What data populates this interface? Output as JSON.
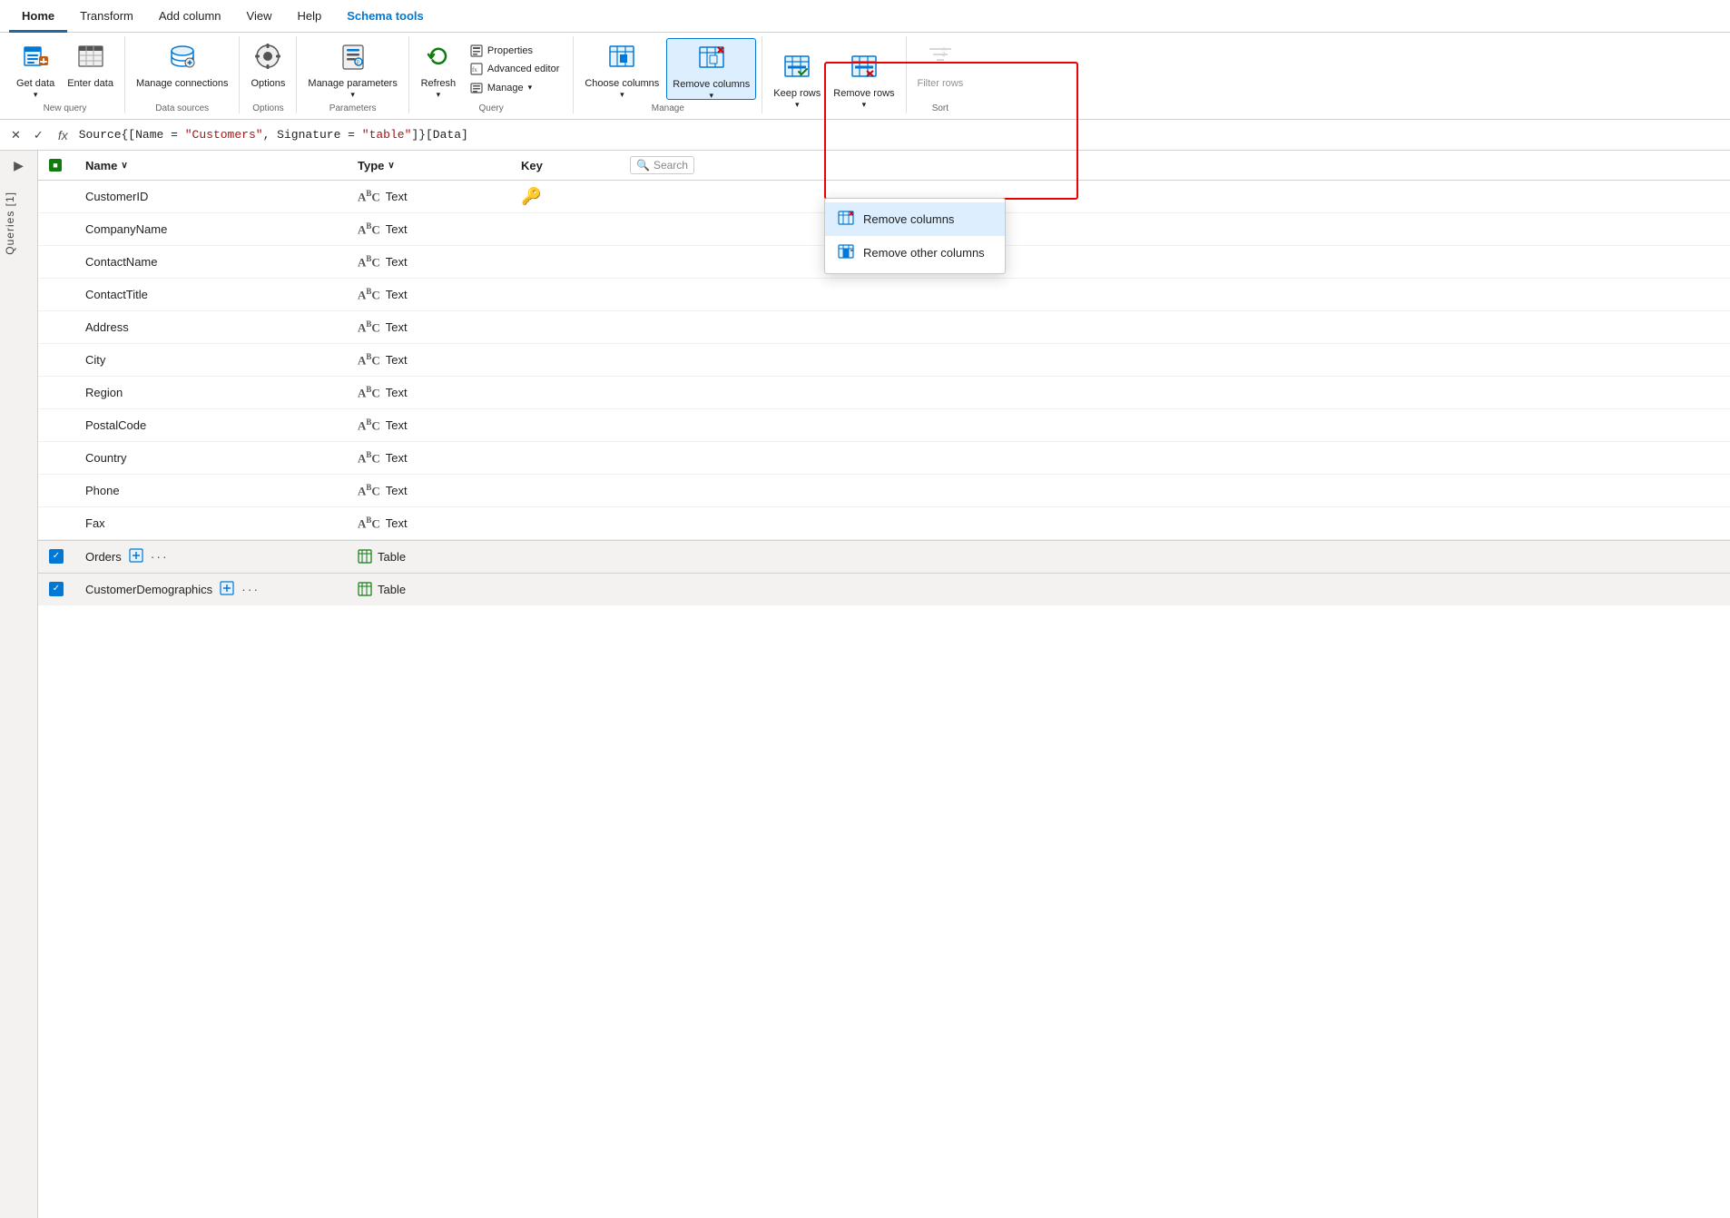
{
  "tabs": [
    {
      "label": "Home",
      "active": true
    },
    {
      "label": "Transform",
      "active": false
    },
    {
      "label": "Add column",
      "active": false
    },
    {
      "label": "View",
      "active": false
    },
    {
      "label": "Help",
      "active": false
    },
    {
      "label": "Schema tools",
      "active": false,
      "schema": true
    }
  ],
  "ribbon": {
    "groups": [
      {
        "label": "New query",
        "buttons": [
          {
            "id": "get-data",
            "label": "Get\ndata",
            "icon": "📊",
            "dropdown": true
          },
          {
            "id": "enter-data",
            "label": "Enter\ndata",
            "icon": "📋"
          }
        ]
      },
      {
        "label": "Data sources",
        "buttons": [
          {
            "id": "manage-connections",
            "label": "Manage\nconnections",
            "icon": "🔧"
          }
        ]
      },
      {
        "label": "Options",
        "buttons": [
          {
            "id": "options",
            "label": "Options",
            "icon": "⚙️"
          }
        ]
      },
      {
        "label": "Parameters",
        "buttons": [
          {
            "id": "manage-parameters",
            "label": "Manage\nparameters",
            "icon": "📝",
            "dropdown": true
          }
        ]
      },
      {
        "label": "Query",
        "buttons": [
          {
            "id": "refresh",
            "label": "Refresh",
            "icon": "🔄",
            "dropdown": true
          },
          {
            "id": "properties",
            "label": "Properties",
            "icon": "📄",
            "small": true
          },
          {
            "id": "advanced-editor",
            "label": "Advanced editor",
            "icon": "📝",
            "small": true
          },
          {
            "id": "manage",
            "label": "Manage",
            "icon": "📋",
            "small": true,
            "dropdown": true
          }
        ]
      },
      {
        "label": "Manage",
        "buttons": [
          {
            "id": "choose-columns",
            "label": "Choose\ncolumns",
            "icon": "▦",
            "dropdown": true
          },
          {
            "id": "remove-columns",
            "label": "Remove\ncolumns",
            "icon": "▦✕",
            "dropdown": true,
            "highlighted": true
          }
        ]
      },
      {
        "label": "",
        "buttons": [
          {
            "id": "keep-rows",
            "label": "Keep\nrows",
            "icon": "≡✓",
            "dropdown": true
          },
          {
            "id": "remove-rows",
            "label": "Remove\nrows",
            "icon": "≡✕",
            "dropdown": true
          }
        ]
      },
      {
        "label": "Sort",
        "buttons": [
          {
            "id": "filter-rows",
            "label": "Filter\nrows",
            "icon": "▽",
            "disabled": true
          }
        ]
      }
    ]
  },
  "formula_bar": {
    "text": "Source{[Name = \"Customers\", Signature = \"table\"]}[Data]",
    "display": "Source{[Name = ",
    "name_val": "\"Customers\"",
    "middle": ", Signature = ",
    "sig_val": "\"table\"",
    "end": "]}[Data]"
  },
  "table": {
    "columns": [
      {
        "label": "Name",
        "has_dropdown": true
      },
      {
        "label": "Type",
        "has_dropdown": true
      },
      {
        "label": "Key"
      },
      {
        "label": "Search",
        "is_search": true
      }
    ],
    "rows": [
      {
        "name": "CustomerID",
        "type": "Text",
        "key": true,
        "type_icon": "ABC"
      },
      {
        "name": "CompanyName",
        "type": "Text",
        "key": false,
        "type_icon": "ABC"
      },
      {
        "name": "ContactName",
        "type": "Text",
        "key": false,
        "type_icon": "ABC"
      },
      {
        "name": "ContactTitle",
        "type": "Text",
        "key": false,
        "type_icon": "ABC"
      },
      {
        "name": "Address",
        "type": "Text",
        "key": false,
        "type_icon": "ABC"
      },
      {
        "name": "City",
        "type": "Text",
        "key": false,
        "type_icon": "ABC"
      },
      {
        "name": "Region",
        "type": "Text",
        "key": false,
        "type_icon": "ABC"
      },
      {
        "name": "PostalCode",
        "type": "Text",
        "key": false,
        "type_icon": "ABC"
      },
      {
        "name": "Country",
        "type": "Text",
        "key": false,
        "type_icon": "ABC"
      },
      {
        "name": "Phone",
        "type": "Text",
        "key": false,
        "type_icon": "ABC"
      },
      {
        "name": "Fax",
        "type": "Text",
        "key": false,
        "type_icon": "ABC"
      }
    ],
    "query_rows": [
      {
        "name": "Orders",
        "type": "Table",
        "checked": true
      },
      {
        "name": "CustomerDemographics",
        "type": "Table",
        "checked": true
      }
    ]
  },
  "queries_label": "Queries [1]",
  "dropdown_menu": {
    "items": [
      {
        "id": "remove-columns",
        "label": "Remove columns",
        "icon": "▦✕",
        "selected": true
      },
      {
        "id": "remove-other-columns",
        "label": "Remove other columns",
        "icon": "▦|"
      }
    ]
  },
  "colors": {
    "accent": "#0078d4",
    "tab_active_border": "#1f6aa5",
    "schema_tools_color": "#0078d4",
    "highlight_border": "#cc0000",
    "green_table_icon": "#107c10",
    "checkbox_bg": "#0078d4"
  }
}
